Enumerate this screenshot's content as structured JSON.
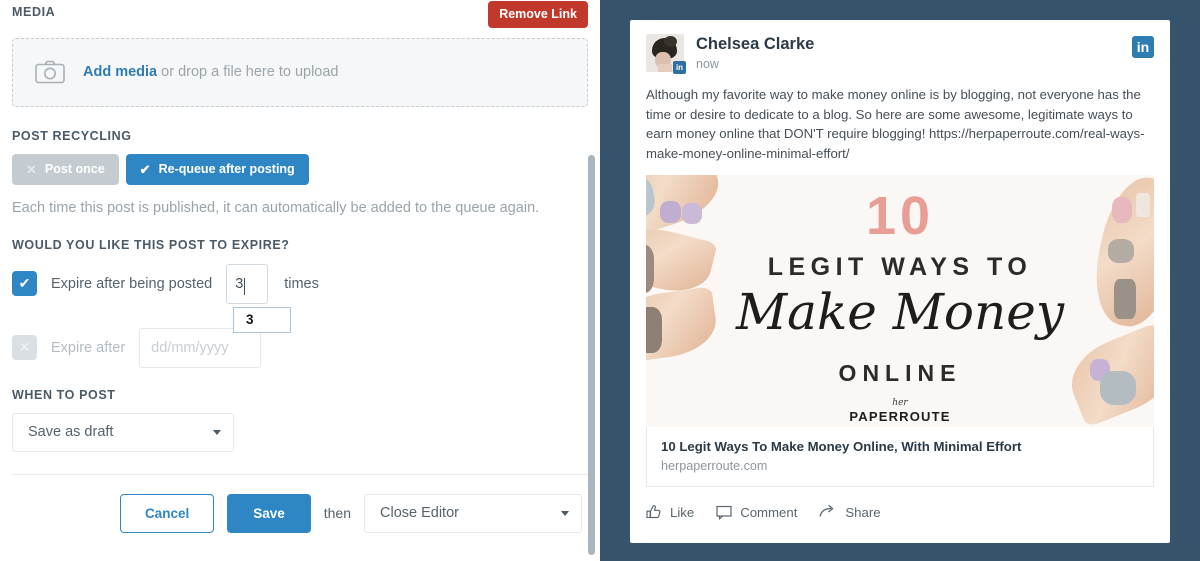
{
  "editor": {
    "media": {
      "label": "MEDIA",
      "remove_link_label": "Remove Link",
      "dropzone_link": "Add media",
      "dropzone_rest": " or drop a file here to upload",
      "camera_icon": "camera-icon"
    },
    "recycling": {
      "label": "POST RECYCLING",
      "post_once_label": "Post once",
      "post_once_glyph": "✕",
      "requeue_label": "Re-queue after posting",
      "requeue_glyph": "✔",
      "helper_text": "Each time this post is published, it can automatically be added to the queue again."
    },
    "expire": {
      "label": "WOULD YOU LIKE THIS POST TO EXPIRE?",
      "count_checkbox_glyph": "✔",
      "count_label": "Expire after being posted",
      "count_value": "3",
      "times_word": "times",
      "autofill_suggestion": "3",
      "date_checkbox_glyph": "✕",
      "date_label": "Expire after",
      "date_placeholder": "dd/mm/yyyy"
    },
    "when_to_post": {
      "label": "WHEN TO POST",
      "selected": "Save as draft"
    },
    "actions": {
      "cancel_label": "Cancel",
      "save_label": "Save",
      "then_label": "then",
      "after_save_selected": "Close Editor"
    }
  },
  "preview": {
    "network_icon": "linkedin-icon",
    "network_mark": "in",
    "author_name": "Chelsea Clarke",
    "timestamp": "now",
    "body": "Although my favorite way to make money online is by blogging, not everyone has the time or desire to dedicate to a blog. So here are some awesome, legitimate ways to earn money online that DON'T require blogging! https://herpaperroute.com/real-ways-make-money-online-minimal-effort/",
    "hero_image": {
      "number": "10",
      "line1": "LEGIT WAYS TO",
      "script": "Make Money",
      "line2": "ONLINE",
      "brand_small": "her",
      "brand_large": "PAPERROUTE"
    },
    "link_card": {
      "title": "10 Legit Ways To Make Money Online, With Minimal Effort",
      "domain": "herpaperroute.com"
    },
    "reactions": [
      {
        "icon": "thumbs-up-icon",
        "label": "Like"
      },
      {
        "icon": "comment-bubble-icon",
        "label": "Comment"
      },
      {
        "icon": "share-arrow-icon",
        "label": "Share"
      }
    ]
  },
  "colors": {
    "accent_blue": "#2f86c4",
    "danger_red": "#c0392b",
    "preview_bg": "#35536b",
    "linkedin_blue": "#2f7cb0"
  }
}
